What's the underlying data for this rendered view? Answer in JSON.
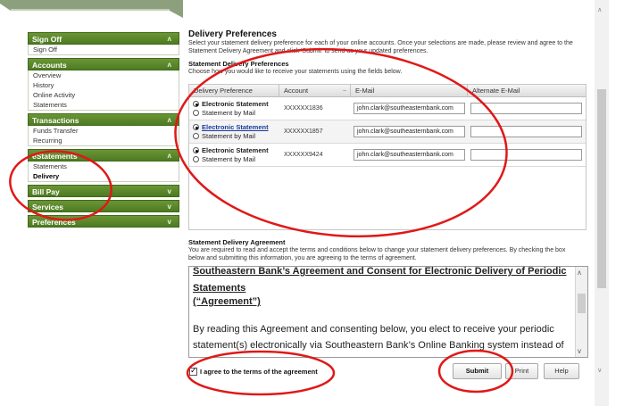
{
  "sidebar": {
    "sections": [
      {
        "title": "Sign Off",
        "chevron": "»",
        "items": [
          {
            "label": "Sign Off"
          }
        ]
      },
      {
        "title": "Accounts",
        "chevron": "»",
        "items": [
          {
            "label": "Overview"
          },
          {
            "label": "History"
          },
          {
            "label": "Online Activity"
          },
          {
            "label": "Statements"
          }
        ]
      },
      {
        "title": "Transactions",
        "chevron": "»",
        "items": [
          {
            "label": "Funds Transfer"
          },
          {
            "label": "Recurring"
          }
        ]
      },
      {
        "title": "eStatements",
        "chevron": "»",
        "items": [
          {
            "label": "Statements"
          },
          {
            "label": "Delivery"
          }
        ]
      },
      {
        "title": "Bill Pay",
        "chevron": "»"
      },
      {
        "title": "Services",
        "chevron": "»"
      },
      {
        "title": "Preferences",
        "chevron": "»"
      }
    ]
  },
  "main": {
    "title": "Delivery Preferences",
    "intro_1": "Select your statement delivery preference for each of your online accounts. Once your selections are made, please review and agree to the",
    "intro_2": "Statement Delivery Agreement and click 'Submit' to send us your updated preferences.",
    "section_title": "Statement Delivery Preferences",
    "section_desc": "Choose how you would like to receive your statements using the fields below.",
    "columns": {
      "pref": "Delivery Preference",
      "account": "Account",
      "sort": "–",
      "email": "E-Mail",
      "alt": "Alternate E-Mail"
    },
    "rows": [
      {
        "opt1": "Electronic Statement",
        "opt2": "Statement by Mail",
        "account": "XXXXXX1836",
        "email": "john.clark@southeasternbank.com",
        "alt": ""
      },
      {
        "opt1": "Electronic Statement",
        "opt2": "Statement by Mail",
        "account": "XXXXXX1857",
        "email": "john.clark@southeasternbank.com",
        "alt": ""
      },
      {
        "opt1": "Electronic Statement",
        "opt2": "Statement by Mail",
        "account": "XXXXXX9424",
        "email": "john.clark@southeasternbank.com",
        "alt": ""
      }
    ],
    "agreement_title": "Statement Delivery Agreement",
    "agreement_desc_1": "You are required to read and accept the terms and conditions below to change your statement delivery preferences. By checking the box",
    "agreement_desc_2": "below and submitting this information, you are agreeing to the terms of agreement.",
    "tos_title_1": "Southeastern Bank’s Agreement and Consent for Electronic Delivery of Periodic Statements",
    "tos_title_2": "(“Agreement”)",
    "tos_body": "By reading this Agreement and consenting below, you elect to receive your periodic statement(s) electronically via Southeastern Bank’s Online Banking system instead of receiving paper statements in the mail.",
    "agree_label": "I agree to the terms of the agreement",
    "buttons": {
      "submit": "Submit",
      "print": "Print",
      "help": "Help"
    }
  },
  "colors": {
    "nav_green": "#5a8a2a",
    "annotation_red": "#e01818",
    "link_blue": "#1a3c9a"
  }
}
